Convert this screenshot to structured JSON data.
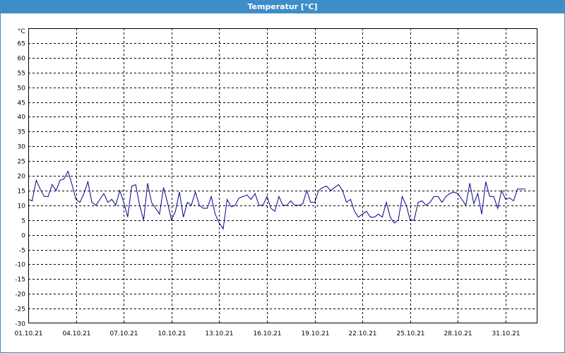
{
  "window": {
    "title": "Temperatur [°C]"
  },
  "colors": {
    "titlebar": "#3c8dc8",
    "line": "#00008b",
    "grid": "#000000"
  },
  "chart_data": {
    "type": "line",
    "title": "Temperatur [°C]",
    "ylabel": "°C",
    "xlabel": "",
    "ylim": [
      -30,
      70
    ],
    "yticks": [
      65,
      60,
      55,
      50,
      45,
      40,
      35,
      30,
      25,
      20,
      15,
      10,
      5,
      0,
      -5,
      -10,
      -15,
      -20,
      -25,
      -30
    ],
    "xlim": [
      "01.10.21",
      "02.11.21"
    ],
    "xticks": [
      "01.10.21",
      "04.10.21",
      "07.10.21",
      "10.10.21",
      "13.10.21",
      "16.10.21",
      "19.10.21",
      "22.10.21",
      "25.10.21",
      "28.10.21",
      "31.10.21"
    ],
    "grid": true,
    "series": [
      {
        "values": [
          [
            "01.10.21 00:00",
            12
          ],
          [
            "01.10.21 06:00",
            11.5
          ],
          [
            "01.10.21 12:00",
            18.5
          ],
          [
            "01.10.21 18:00",
            15.5
          ],
          [
            "02.10.21 00:00",
            13
          ],
          [
            "02.10.21 06:00",
            13
          ],
          [
            "02.10.21 12:00",
            17
          ],
          [
            "02.10.21 18:00",
            15
          ],
          [
            "03.10.21 00:00",
            18.5
          ],
          [
            "03.10.21 06:00",
            19
          ],
          [
            "03.10.21 12:00",
            21.5
          ],
          [
            "03.10.21 18:00",
            17
          ],
          [
            "04.10.21 00:00",
            12
          ],
          [
            "04.10.21 06:00",
            11
          ],
          [
            "04.10.21 12:00",
            14
          ],
          [
            "04.10.21 18:00",
            18
          ],
          [
            "05.10.21 00:00",
            11
          ],
          [
            "05.10.21 06:00",
            10
          ],
          [
            "05.10.21 12:00",
            12
          ],
          [
            "05.10.21 18:00",
            14
          ],
          [
            "06.10.21 00:00",
            11
          ],
          [
            "06.10.21 06:00",
            12
          ],
          [
            "06.10.21 12:00",
            10
          ],
          [
            "06.10.21 18:00",
            15
          ],
          [
            "07.10.21 00:00",
            11
          ],
          [
            "07.10.21 06:00",
            6
          ],
          [
            "07.10.21 12:00",
            16.5
          ],
          [
            "07.10.21 18:00",
            17
          ],
          [
            "08.10.21 00:00",
            10
          ],
          [
            "08.10.21 06:00",
            5
          ],
          [
            "08.10.21 12:00",
            17.5
          ],
          [
            "08.10.21 18:00",
            11
          ],
          [
            "09.10.21 00:00",
            9
          ],
          [
            "09.10.21 06:00",
            7
          ],
          [
            "09.10.21 12:00",
            16
          ],
          [
            "09.10.21 18:00",
            11
          ],
          [
            "10.10.21 00:00",
            5
          ],
          [
            "10.10.21 06:00",
            8
          ],
          [
            "10.10.21 12:00",
            14.5
          ],
          [
            "10.10.21 18:00",
            6
          ],
          [
            "11.10.21 00:00",
            11
          ],
          [
            "11.10.21 06:00",
            10
          ],
          [
            "11.10.21 12:00",
            14.5
          ],
          [
            "11.10.21 18:00",
            10
          ],
          [
            "12.10.21 00:00",
            9
          ],
          [
            "12.10.21 06:00",
            9
          ],
          [
            "12.10.21 12:00",
            13
          ],
          [
            "12.10.21 18:00",
            7
          ],
          [
            "13.10.21 00:00",
            4
          ],
          [
            "13.10.21 06:00",
            2
          ],
          [
            "13.10.21 12:00",
            12
          ],
          [
            "13.10.21 18:00",
            9.5
          ],
          [
            "14.10.21 00:00",
            10
          ],
          [
            "14.10.21 06:00",
            12.5
          ],
          [
            "14.10.21 12:00",
            13
          ],
          [
            "14.10.21 18:00",
            13.5
          ],
          [
            "15.10.21 00:00",
            12
          ],
          [
            "15.10.21 06:00",
            14
          ],
          [
            "15.10.21 12:00",
            10
          ],
          [
            "15.10.21 18:00",
            10
          ],
          [
            "16.10.21 00:00",
            13
          ],
          [
            "16.10.21 06:00",
            9
          ],
          [
            "16.10.21 12:00",
            8
          ],
          [
            "16.10.21 18:00",
            13
          ],
          [
            "17.10.21 00:00",
            10
          ],
          [
            "17.10.21 06:00",
            10
          ],
          [
            "17.10.21 12:00",
            11.5
          ],
          [
            "17.10.21 18:00",
            10
          ],
          [
            "18.10.21 00:00",
            10
          ],
          [
            "18.10.21 06:00",
            10.5
          ],
          [
            "18.10.21 12:00",
            15
          ],
          [
            "18.10.21 18:00",
            11
          ],
          [
            "19.10.21 00:00",
            11
          ],
          [
            "19.10.21 06:00",
            15
          ],
          [
            "19.10.21 12:00",
            16
          ],
          [
            "19.10.21 18:00",
            16.5
          ],
          [
            "20.10.21 00:00",
            15
          ],
          [
            "20.10.21 06:00",
            16
          ],
          [
            "20.10.21 12:00",
            17
          ],
          [
            "20.10.21 18:00",
            15
          ],
          [
            "21.10.21 00:00",
            11
          ],
          [
            "21.10.21 06:00",
            12
          ],
          [
            "21.10.21 12:00",
            8
          ],
          [
            "21.10.21 18:00",
            6
          ],
          [
            "22.10.21 00:00",
            7
          ],
          [
            "22.10.21 06:00",
            8
          ],
          [
            "22.10.21 12:00",
            6
          ],
          [
            "22.10.21 18:00",
            6
          ],
          [
            "23.10.21 00:00",
            7
          ],
          [
            "23.10.21 06:00",
            6
          ],
          [
            "23.10.21 12:00",
            11
          ],
          [
            "23.10.21 18:00",
            6
          ],
          [
            "24.10.21 00:00",
            4
          ],
          [
            "24.10.21 06:00",
            5
          ],
          [
            "24.10.21 12:00",
            13
          ],
          [
            "24.10.21 18:00",
            10
          ],
          [
            "25.10.21 00:00",
            5
          ],
          [
            "25.10.21 06:00",
            5
          ],
          [
            "25.10.21 12:00",
            11
          ],
          [
            "25.10.21 18:00",
            11.5
          ],
          [
            "26.10.21 00:00",
            10
          ],
          [
            "26.10.21 06:00",
            11
          ],
          [
            "26.10.21 12:00",
            13
          ],
          [
            "26.10.21 18:00",
            13
          ],
          [
            "27.10.21 00:00",
            11
          ],
          [
            "27.10.21 06:00",
            13
          ],
          [
            "27.10.21 12:00",
            14
          ],
          [
            "27.10.21 18:00",
            14.5
          ],
          [
            "28.10.21 00:00",
            14
          ],
          [
            "28.10.21 06:00",
            12
          ],
          [
            "28.10.21 12:00",
            10
          ],
          [
            "28.10.21 18:00",
            17.5
          ],
          [
            "29.10.21 00:00",
            10.5
          ],
          [
            "29.10.21 06:00",
            14
          ],
          [
            "29.10.21 12:00",
            7
          ],
          [
            "29.10.21 18:00",
            18
          ],
          [
            "30.10.21 00:00",
            13
          ],
          [
            "30.10.21 06:00",
            13
          ],
          [
            "30.10.21 12:00",
            9
          ],
          [
            "30.10.21 18:00",
            15
          ],
          [
            "31.10.21 00:00",
            12
          ],
          [
            "31.10.21 06:00",
            12.5
          ],
          [
            "31.10.21 12:00",
            11.5
          ],
          [
            "31.10.21 18:00",
            15.5
          ],
          [
            "01.11.21 00:00",
            15.5
          ],
          [
            "01.11.21 06:00",
            15.5
          ]
        ]
      }
    ]
  }
}
